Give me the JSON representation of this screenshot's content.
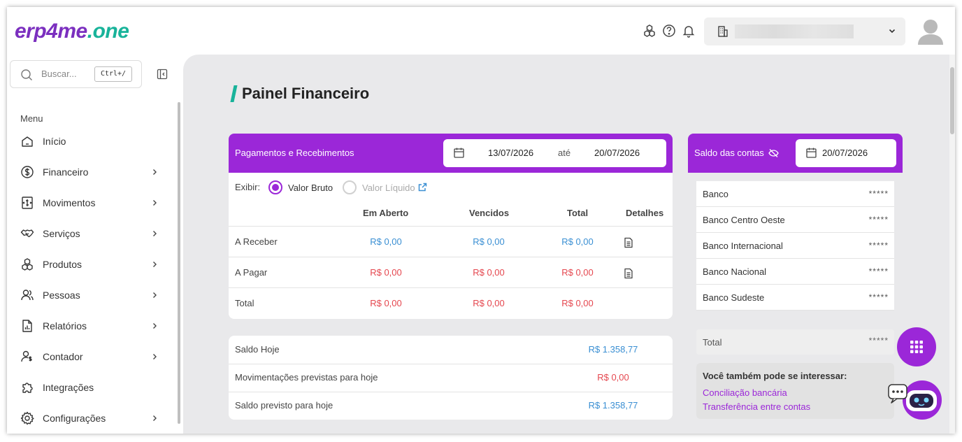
{
  "logo": {
    "part1": "erp4me",
    "part2": ".one"
  },
  "header": {
    "icons": [
      "modules-icon",
      "help-icon",
      "bell-icon"
    ],
    "company_icon": "building-icon"
  },
  "search": {
    "placeholder": "Buscar...",
    "shortcut": "Ctrl+/"
  },
  "sidebar": {
    "menu_label": "Menu",
    "items": [
      {
        "label": "Início",
        "icon": "home-icon",
        "chevron": false
      },
      {
        "label": "Financeiro",
        "icon": "dollar-icon",
        "chevron": true
      },
      {
        "label": "Movimentos",
        "icon": "movements-icon",
        "chevron": true
      },
      {
        "label": "Serviços",
        "icon": "handshake-icon",
        "chevron": true
      },
      {
        "label": "Produtos",
        "icon": "boxes-icon",
        "chevron": true
      },
      {
        "label": "Pessoas",
        "icon": "people-icon",
        "chevron": true
      },
      {
        "label": "Relatórios",
        "icon": "report-icon",
        "chevron": true
      },
      {
        "label": "Contador",
        "icon": "accountant-icon",
        "chevron": true
      },
      {
        "label": "Integrações",
        "icon": "puzzle-icon",
        "chevron": false
      },
      {
        "label": "Configurações",
        "icon": "gear-icon",
        "chevron": true
      }
    ]
  },
  "page": {
    "title": "Painel Financeiro"
  },
  "payments": {
    "title": "Pagamentos e Recebimentos",
    "date_from": "13/07/2026",
    "date_sep": "até",
    "date_to": "20/07/2026",
    "exibir": "Exibir:",
    "opt_bruto": "Valor Bruto",
    "opt_liquido": "Valor Líquido",
    "columns": [
      "Em Aberto",
      "Vencidos",
      "Total",
      "Detalhes"
    ],
    "rows": [
      {
        "label": "A Receber",
        "aberto": "R$ 0,00",
        "vencidos": "R$ 0,00",
        "total": "R$ 0,00"
      },
      {
        "label": "A Pagar",
        "aberto": "R$ 0,00",
        "vencidos": "R$ 0,00",
        "total": "R$ 0,00"
      },
      {
        "label": "Total",
        "aberto": "R$ 0,00",
        "vencidos": "R$ 0,00",
        "total": "R$ 0,00"
      }
    ]
  },
  "summary": [
    {
      "label": "Saldo Hoje",
      "value": "R$ 1.358,77"
    },
    {
      "label": "Movimentações previstas para hoje",
      "value": "R$ 0,00"
    },
    {
      "label": "Saldo previsto para hoje",
      "value": "R$ 1.358,77"
    }
  ],
  "balances": {
    "title": "Saldo das contas",
    "date": "20/07/2026",
    "banks": [
      {
        "name": "Banco",
        "value": "*****"
      },
      {
        "name": "Banco Centro Oeste",
        "value": "*****"
      },
      {
        "name": "Banco Internacional",
        "value": "*****"
      },
      {
        "name": "Banco Nacional",
        "value": "*****"
      },
      {
        "name": "Banco Sudeste",
        "value": "*****"
      }
    ],
    "total_label": "Total",
    "total_value": "*****",
    "interest_title": "Você também pode se interessar:",
    "links": [
      "Conciliação bancária",
      "Transferência entre contas"
    ]
  },
  "colors": {
    "purple": "#9b27d8",
    "teal": "#18b39a",
    "blue": "#3a8fd3",
    "red": "#e5474f"
  }
}
